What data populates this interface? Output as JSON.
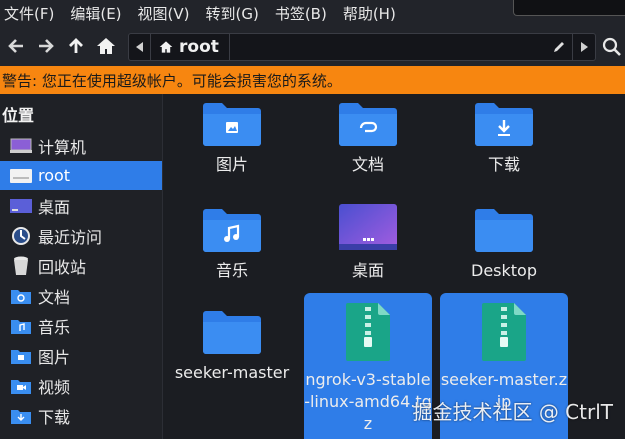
{
  "menubar": {
    "items": [
      "文件(F)",
      "编辑(E)",
      "视图(V)",
      "转到(G)",
      "书签(B)",
      "帮助(H)"
    ]
  },
  "toolbar": {
    "back_icon": "arrow-left-icon",
    "forward_icon": "arrow-right-icon",
    "up_icon": "arrow-up-icon",
    "home_icon": "home-icon",
    "path": {
      "crumb_label": "root",
      "crumb_icon": "home-icon",
      "edit_icon": "pencil-icon"
    },
    "search_icon": "search-icon"
  },
  "warning": {
    "text": "警告: 您正在使用超级帐户。可能会损害您的系统。",
    "color": "#f78610"
  },
  "sidebar": {
    "heading": "位置",
    "items": [
      {
        "label": "计算机",
        "icon": "computer-icon"
      },
      {
        "label": "root",
        "icon": "home-folder-icon",
        "selected": true
      },
      {
        "label": "桌面",
        "icon": "desktop-icon"
      },
      {
        "label": "最近访问",
        "icon": "recent-icon"
      },
      {
        "label": "回收站",
        "icon": "trash-icon"
      },
      {
        "label": "文档",
        "icon": "documents-folder-icon"
      },
      {
        "label": "音乐",
        "icon": "music-folder-icon"
      },
      {
        "label": "图片",
        "icon": "pictures-folder-icon"
      },
      {
        "label": "视频",
        "icon": "videos-folder-icon"
      },
      {
        "label": "下载",
        "icon": "downloads-folder-icon"
      }
    ],
    "accent": "#2f7de8"
  },
  "files": [
    {
      "label": "图片",
      "icon": "pictures-folder-icon"
    },
    {
      "label": "文档",
      "icon": "documents-folder-icon"
    },
    {
      "label": "下载",
      "icon": "downloads-folder-icon"
    },
    {
      "label": "音乐",
      "icon": "music-folder-icon"
    },
    {
      "label": "桌面",
      "icon": "desktop-folder-icon"
    },
    {
      "label": "Desktop",
      "icon": "folder-icon"
    },
    {
      "label": "seeker-master",
      "icon": "folder-icon"
    },
    {
      "label": "ngrok-v3-stable-linux-amd64.tgz",
      "icon": "archive-icon",
      "selected": true
    },
    {
      "label": "seeker-master.zip",
      "icon": "archive-icon",
      "selected": true
    }
  ],
  "watermark": "掘金技术社区 @ CtrlT"
}
